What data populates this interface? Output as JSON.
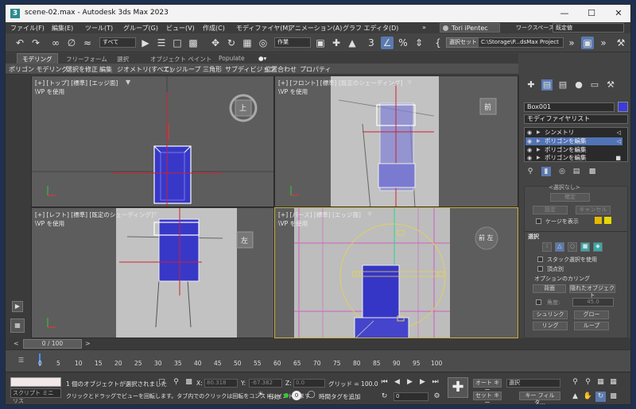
{
  "window": {
    "title": "scene-02.max - Autodesk 3ds Max 2023"
  },
  "menu": [
    "ファイル(F)",
    "編集(E)",
    "ツール(T)",
    "グループ(G)",
    "ビュー(V)",
    "作成(C)",
    "モディファイヤ(M)",
    "アニメーション(A)",
    "グラフ エディタ(D)"
  ],
  "menu_more": "»",
  "user": "Tori iPentec",
  "workspace": {
    "label": "ワークスペース:",
    "value": "既定値"
  },
  "toolbar": {
    "filter_select": "すべて",
    "named_sel": "作業",
    "selection_set": "選択セット",
    "project_path": "C:\\Storage\\P...dsMax Project"
  },
  "ribbon": {
    "tabs": [
      "モデリング",
      "フリーフォーム",
      "選択",
      "オブジェクト ペイント",
      "Populate"
    ],
    "items": [
      "ポリゴン モデリング",
      "選択を修正",
      "編集",
      "ジオメトリ(すべて)",
      "エッジ",
      "ループ",
      "三角形",
      "サブディビジョン",
      "位置合わせ",
      "プロパティ"
    ]
  },
  "viewports": {
    "top": {
      "label": "[+] [トップ] [標準] [エッジ面]",
      "sub": "\\VP を使用",
      "cube": "上"
    },
    "front": {
      "label": "[+] [フロント] [標準] [既定のシェーディング]",
      "sub": "\\VP を使用",
      "cube": "前"
    },
    "left": {
      "label": "[+] [レフト] [標準] [既定のシェーディング]",
      "sub": "\\VP を使用",
      "cube": "左"
    },
    "persp": {
      "label": "[+] [パース] [標準] [エッジ面]",
      "sub": "\\VP を使用",
      "cube": "前 左"
    }
  },
  "command_panel": {
    "object_name": "Box001",
    "object_color": "#3c3cd8",
    "modifier_list": "モディファイヤリスト",
    "stack": [
      "シンメトリ",
      "ポリゴンを編集",
      "ポリゴンを編集",
      "ポリゴンを編集"
    ],
    "rollout_title": "<選択なし>",
    "commit": "確定",
    "set": "設定",
    "cancel": "キャンセル",
    "show_cage": "ケージを表示",
    "selection_header": "選択",
    "stack_sel": "スタック選択を使用",
    "by_vertex": "頂点別",
    "culling": "オプションのカリング",
    "backface": "背面",
    "occluded": "隠れたオブジェクト",
    "angle_label": "角度:",
    "angle_value": "45.0",
    "shrink": "シュリンク",
    "grow": "グロー",
    "ring": "リング",
    "loop": "ループ"
  },
  "timeline": {
    "slider": "0 / 100",
    "ticks": [
      "0",
      "5",
      "10",
      "15",
      "20",
      "25",
      "30",
      "35",
      "40",
      "45",
      "50",
      "55",
      "60",
      "65",
      "70",
      "75",
      "80",
      "85",
      "90",
      "95",
      "100"
    ]
  },
  "status": {
    "script": "スクリプト ミニ リス",
    "msg1": "1 個のオブジェクトが選択されました",
    "msg2": "クリックとドラッグでビューを回転します。タブ内でのクリックは回転をコンストレイントします",
    "x_label": "X:",
    "x": "80.318",
    "y_label": "Y:",
    "y": "-67.382",
    "z_label": "Z:",
    "z": "0.0",
    "grid": "グリッド = 100.0",
    "enabled": "有効:",
    "addtime": "時間タグを追加",
    "frame": "0",
    "autokey": "オート キー",
    "selected": "選択",
    "setkey": "セット キー",
    "keyfilter": "キー フィルタ..."
  }
}
